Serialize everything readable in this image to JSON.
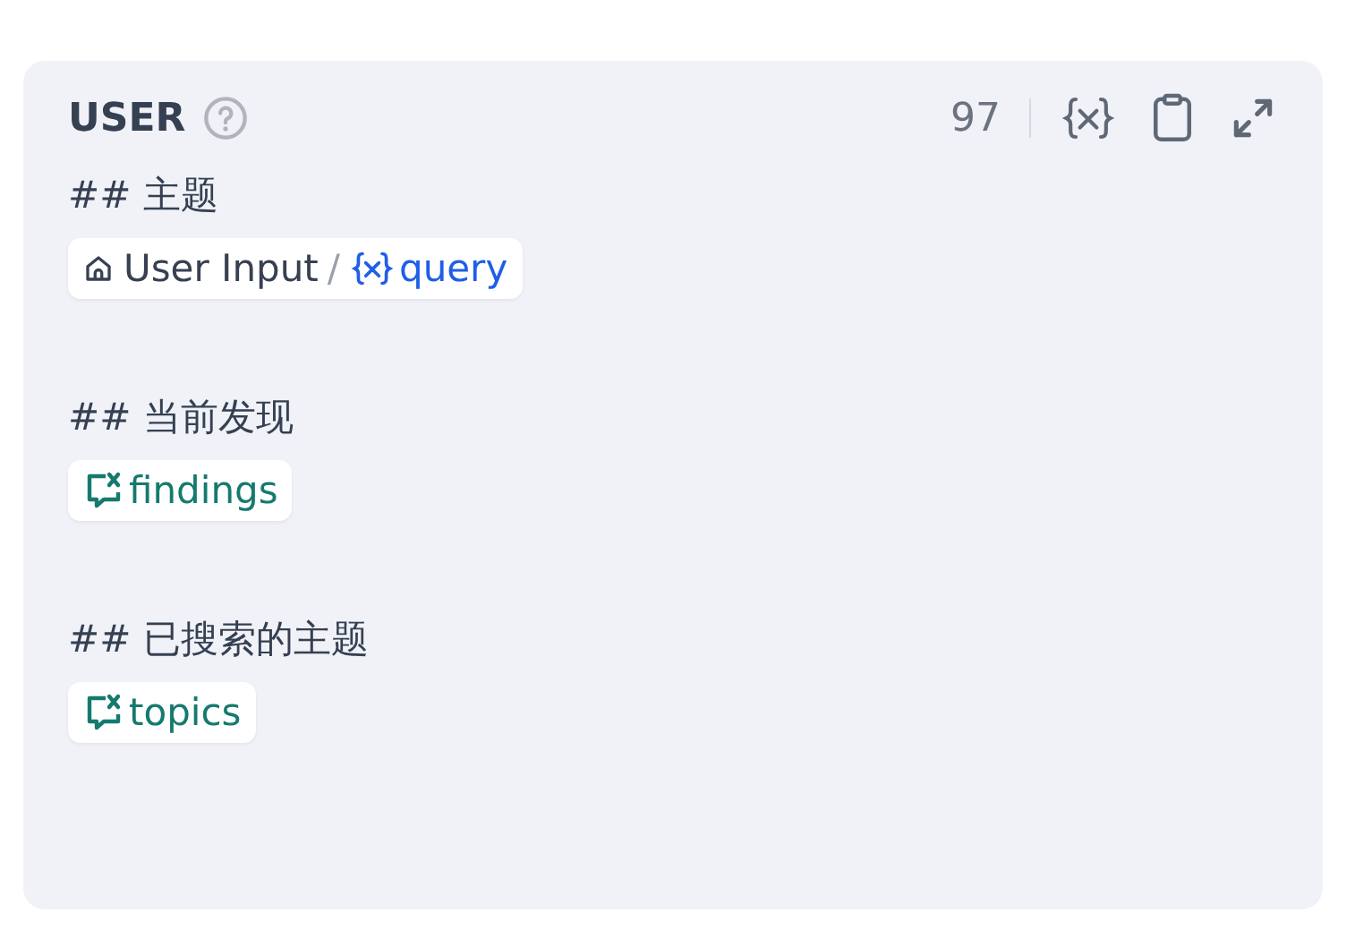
{
  "panel": {
    "title": "USER",
    "count": "97",
    "lines": [
      {
        "kind": "text",
        "text": "## 主题"
      },
      {
        "kind": "node_var",
        "source": "User Input",
        "separator": "/",
        "name": "query"
      },
      {
        "kind": "blank"
      },
      {
        "kind": "text",
        "text": "## 当前发现"
      },
      {
        "kind": "chat_var",
        "name": "findings"
      },
      {
        "kind": "blank"
      },
      {
        "kind": "text",
        "text": "## 已搜索的主题"
      },
      {
        "kind": "chat_var",
        "name": "topics"
      }
    ]
  }
}
